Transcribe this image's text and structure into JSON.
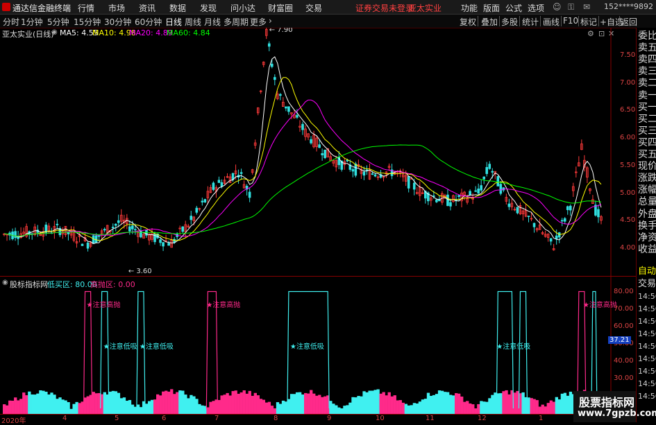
{
  "menubar": {
    "app_title": "通达信金融终端",
    "items": [
      "行情",
      "市场",
      "资讯",
      "数据",
      "发现",
      "问小达",
      "财富圈",
      "交易"
    ],
    "status_warning": "证券交易未登录",
    "stock_link": "亚太实业",
    "right_items": [
      "功能",
      "版面",
      "公式",
      "选项"
    ],
    "account": "152****9892"
  },
  "period_bar": {
    "periods": [
      "分时",
      "1分钟",
      "5分钟",
      "15分钟",
      "30分钟",
      "60分钟",
      "日线",
      "周线",
      "月线",
      "多周期",
      "更多"
    ],
    "active": "日线",
    "tools": [
      "复权",
      "叠加",
      "多股",
      "统计",
      "画线",
      "F10",
      "标记",
      "+自选",
      "返回"
    ]
  },
  "main_chart": {
    "stock_label": "亚太实业(日线)",
    "ma": [
      {
        "label": "MA5: 4.55",
        "color": "#ffffff"
      },
      {
        "label": "MA10: 4.98",
        "color": "#ffff00"
      },
      {
        "label": "MA20: 4.89",
        "color": "#ff00ff"
      },
      {
        "label": "MA60: 4.84",
        "color": "#00ff00"
      }
    ],
    "high_marker": "7.90",
    "low_marker": "3.60",
    "price_ticks": [
      "7.50",
      "7.00",
      "6.50",
      "6.00",
      "5.50",
      "5.00",
      "4.50",
      "4.00"
    ]
  },
  "indicator": {
    "name": "股标指标网",
    "param1": "低买区: 80.00",
    "param2": "高抛区: 0.00",
    "value_badge": "37.21",
    "ticks": [
      "80.00",
      "70.00",
      "60.00",
      "50.00",
      "40.00",
      "30.00",
      "20.00"
    ],
    "annotation_sell": "注意高抛",
    "annotation_buy": "注意低吸"
  },
  "x_axis": {
    "labels": [
      "2020年",
      "4",
      "5",
      "6",
      "7",
      "8",
      "9",
      "10",
      "11",
      "12",
      "1"
    ]
  },
  "side_panel": {
    "quote_items": [
      "委比",
      "卖五",
      "卖四",
      "卖三",
      "卖二",
      "卖一",
      "买一",
      "买二",
      "买三",
      "买四",
      "买五",
      "现价",
      "涨跌",
      "涨幅",
      "总量",
      "外盘",
      "换手",
      "净资",
      "收益"
    ],
    "lower_items": [
      "自动",
      "交易",
      "14:56",
      "14:56",
      "14:56",
      "14:56",
      "14:56",
      "14:56",
      "14:56",
      "14:56",
      "14:56"
    ]
  },
  "watermark": {
    "line1": "股票指标网",
    "line2": "www.7gpzb.com"
  },
  "colors": {
    "up": "#ff3a3a",
    "down": "#30e0e0",
    "ma5": "#ffffff",
    "ma10": "#ffff00",
    "ma20": "#ff00ff",
    "ma60": "#00ff00",
    "indicator_pink": "#ff2a8a",
    "indicator_cyan": "#40f0f0"
  }
}
